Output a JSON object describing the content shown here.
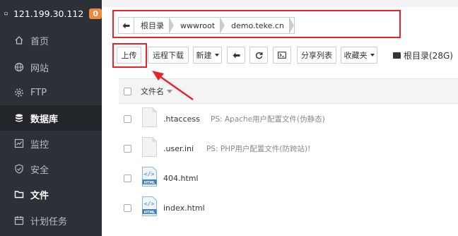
{
  "sidebar": {
    "ip": "121.199.30.112",
    "badge": "0",
    "items": [
      {
        "label": "首页"
      },
      {
        "label": "网站"
      },
      {
        "label": "FTP"
      },
      {
        "label": "数据库"
      },
      {
        "label": "监控"
      },
      {
        "label": "安全"
      },
      {
        "label": "文件"
      },
      {
        "label": "计划任务"
      }
    ]
  },
  "breadcrumb": {
    "segments": [
      "根目录",
      "wwwroot",
      "demo.teke.cn"
    ]
  },
  "toolbar": {
    "upload": "上传",
    "remote_download": "远程下载",
    "new": "新建",
    "share_list": "分享列表",
    "favorites": "收藏夹",
    "disk_label": "根目录(28G)"
  },
  "table": {
    "header_name": "文件名",
    "rows": [
      {
        "name": ".htaccess",
        "desc": "PS: Apache用户配置文件(伪静态)",
        "icon": "file-icon"
      },
      {
        "name": ".user.ini",
        "desc": "PS: PHP用户配置文件(防跨站)!",
        "icon": "file-icon"
      },
      {
        "name": "404.html",
        "desc": "",
        "icon": "html-file-icon"
      },
      {
        "name": "index.html",
        "desc": "",
        "icon": "html-file-icon"
      }
    ]
  },
  "colors": {
    "sidebar_bg": "#2c3138",
    "highlight_red": "#e4262b",
    "badge_orange": "#f0883a"
  }
}
